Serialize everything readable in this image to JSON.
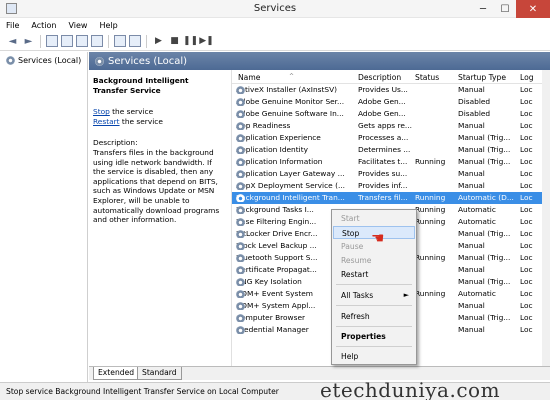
{
  "window": {
    "title": "Services",
    "minimize": "─",
    "maximize": "☐",
    "close": "✕"
  },
  "menu": [
    "File",
    "Action",
    "View",
    "Help"
  ],
  "toolbar": {
    "back": "◄",
    "forward": "►",
    "play": "▶",
    "stop": "■",
    "pause": "❚❚",
    "restart": "▶❚"
  },
  "tree": {
    "item": "Services (Local)"
  },
  "pane_header": "Services (Local)",
  "description_panel": {
    "service_name": "Background Intelligent Transfer Service",
    "stop_link": "Stop",
    "stop_suffix": " the service",
    "restart_link": "Restart",
    "restart_suffix": " the service",
    "description_label": "Description:",
    "description_text": "Transfers files in the background using idle network bandwidth. If the service is disabled, then any applications that depend on BITS, such as Windows Update or MSN Explorer, will be unable to automatically download programs and other information."
  },
  "columns": [
    "Name",
    "Description",
    "Status",
    "Startup Type",
    "Log"
  ],
  "rows": [
    {
      "name": "ActiveX Installer (AxInstSV)",
      "desc": "Provides Us...",
      "status": "",
      "startup": "Manual",
      "log": "Loc"
    },
    {
      "name": "Adobe Genuine Monitor Ser...",
      "desc": "Adobe Gen...",
      "status": "",
      "startup": "Disabled",
      "log": "Loc"
    },
    {
      "name": "Adobe Genuine Software In...",
      "desc": "Adobe Gen...",
      "status": "",
      "startup": "Disabled",
      "log": "Loc"
    },
    {
      "name": "App Readiness",
      "desc": "Gets apps re...",
      "status": "",
      "startup": "Manual",
      "log": "Loc"
    },
    {
      "name": "Application Experience",
      "desc": "Processes a...",
      "status": "",
      "startup": "Manual (Trig...",
      "log": "Loc"
    },
    {
      "name": "Application Identity",
      "desc": "Determines ...",
      "status": "",
      "startup": "Manual (Trig...",
      "log": "Loc"
    },
    {
      "name": "Application Information",
      "desc": "Facilitates t...",
      "status": "Running",
      "startup": "Manual (Trig...",
      "log": "Loc"
    },
    {
      "name": "Application Layer Gateway ...",
      "desc": "Provides su...",
      "status": "",
      "startup": "Manual",
      "log": "Loc"
    },
    {
      "name": "AppX Deployment Service (...",
      "desc": "Provides inf...",
      "status": "",
      "startup": "Manual",
      "log": "Loc"
    },
    {
      "name": "Background Intelligent Tran...",
      "desc": "Transfers fil...",
      "status": "Running",
      "startup": "Automatic (D...",
      "log": "Loc"
    },
    {
      "name": "Background Tasks I...",
      "desc": "",
      "status": "Running",
      "startup": "Automatic",
      "log": "Loc"
    },
    {
      "name": "Base Filtering Engin...",
      "desc": "",
      "status": "Running",
      "startup": "Automatic",
      "log": "Loc"
    },
    {
      "name": "BitLocker Drive Encr...",
      "desc": "",
      "status": "",
      "startup": "Manual (Trig...",
      "log": "Loc"
    },
    {
      "name": "Block Level Backup ...",
      "desc": "",
      "status": "",
      "startup": "Manual",
      "log": "Loc"
    },
    {
      "name": "Bluetooth Support S...",
      "desc": "",
      "status": "Running",
      "startup": "Manual (Trig...",
      "log": "Loc"
    },
    {
      "name": "Certificate Propagat...",
      "desc": "",
      "status": "",
      "startup": "Manual",
      "log": "Loc"
    },
    {
      "name": "CNG Key Isolation",
      "desc": "",
      "status": "",
      "startup": "Manual (Trig...",
      "log": "Loc"
    },
    {
      "name": "COM+ Event System",
      "desc": "",
      "status": "Running",
      "startup": "Automatic",
      "log": "Loc"
    },
    {
      "name": "COM+ System Appl...",
      "desc": "",
      "status": "",
      "startup": "Manual",
      "log": "Loc"
    },
    {
      "name": "Computer Browser",
      "desc": "",
      "status": "",
      "startup": "Manual (Trig...",
      "log": "Loc"
    },
    {
      "name": "Credential Manager",
      "desc": "",
      "status": "",
      "startup": "Manual",
      "log": "Loc"
    }
  ],
  "context_menu": {
    "start": "Start",
    "stop": "Stop",
    "pause": "Pause",
    "resume": "Resume",
    "restart": "Restart",
    "all_tasks": "All Tasks",
    "refresh": "Refresh",
    "properties": "Properties",
    "help": "Help"
  },
  "tabs": [
    "Extended",
    "Standard"
  ],
  "statusbar": "Stop service Background Intelligent Transfer Service on Local Computer",
  "watermark": "etechduniya.com",
  "colors": {
    "selection": "#3a8ee6",
    "header": "#4d6a94",
    "close": "#c7463a"
  }
}
